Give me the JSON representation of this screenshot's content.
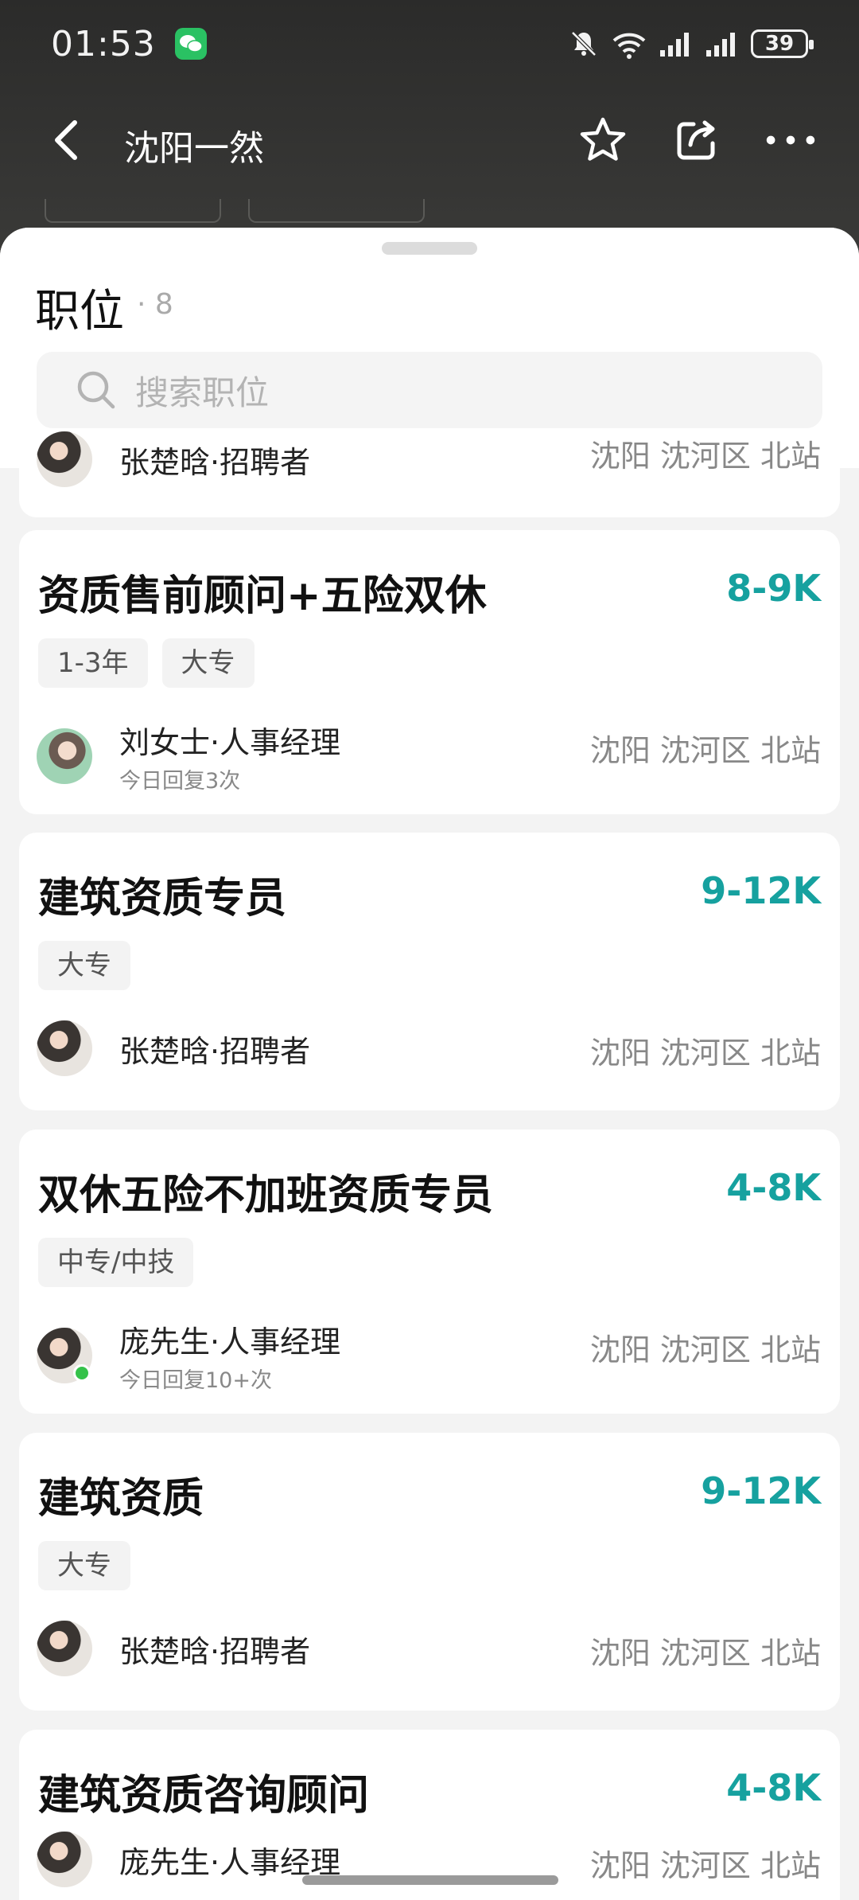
{
  "status_bar": {
    "time": "01:53",
    "battery": "39",
    "icons": [
      "wechat-icon",
      "mute-icon",
      "wifi-icon",
      "signal-icon",
      "signal-icon",
      "battery-icon"
    ]
  },
  "nav": {
    "title": "沈阳一然",
    "icons": [
      "back-icon",
      "star-icon",
      "share-icon",
      "more-icon"
    ]
  },
  "sheet": {
    "title": "职位",
    "count": "· 8",
    "search_placeholder": "搜索职位"
  },
  "partial_top_card": {
    "recruiter": "张楚晗·招聘者",
    "location": "沈阳 沈河区 北站"
  },
  "jobs": [
    {
      "title": "资质售前顾问+五险双休",
      "salary": "8-9K",
      "tags": [
        "1-3年",
        "大专"
      ],
      "recruiter": "刘女士·人事经理",
      "reply": "今日回复3次",
      "location": "沈阳 沈河区 北站"
    },
    {
      "title": "建筑资质专员",
      "salary": "9-12K",
      "tags": [
        "大专"
      ],
      "recruiter": "张楚晗·招聘者",
      "reply": "",
      "location": "沈阳 沈河区 北站"
    },
    {
      "title": "双休五险不加班资质专员",
      "salary": "4-8K",
      "tags": [
        "中专/中技"
      ],
      "recruiter": "庞先生·人事经理",
      "reply": "今日回复10+次",
      "location": "沈阳 沈河区 北站"
    },
    {
      "title": "建筑资质",
      "salary": "9-12K",
      "tags": [
        "大专"
      ],
      "recruiter": "张楚晗·招聘者",
      "reply": "",
      "location": "沈阳 沈河区 北站"
    },
    {
      "title": "建筑资质咨询顾问",
      "salary": "4-8K",
      "tags": [],
      "recruiter": "庞先生·人事经理",
      "reply": "",
      "location": "沈阳 沈河区 北站"
    }
  ],
  "colors": {
    "accent": "#16a19f",
    "header_bg": "#2b2b2a",
    "card_bg": "#ffffff",
    "page_bg": "#f3f3f3"
  }
}
